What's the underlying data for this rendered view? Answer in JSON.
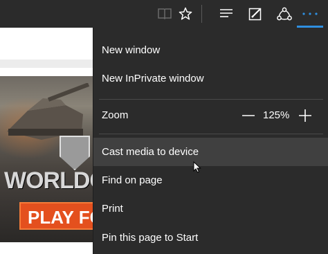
{
  "toolbar": {
    "icons": [
      {
        "name": "reading-view-icon"
      },
      {
        "name": "favorites-star-icon"
      },
      {
        "name": "hub-icon"
      },
      {
        "name": "web-note-icon"
      },
      {
        "name": "share-icon"
      },
      {
        "name": "more-actions-icon"
      }
    ],
    "accent_color": "#2f8fe0"
  },
  "menu": {
    "items": [
      {
        "label": "New window"
      },
      {
        "label": "New InPrivate window"
      },
      {
        "label": "Cast media to device"
      },
      {
        "label": "Find on page"
      },
      {
        "label": "Print"
      },
      {
        "label": "Pin this page to Start"
      }
    ],
    "zoom": {
      "label": "Zoom",
      "value": "125%",
      "decrease_icon": "minus-icon",
      "increase_icon": "plus-icon"
    },
    "hovered_item": "Cast media to device",
    "background_color": "#2b2b2b",
    "hover_color": "#404040"
  },
  "ad": {
    "title": "WORLDOFT",
    "button": "PLAY FOR"
  }
}
